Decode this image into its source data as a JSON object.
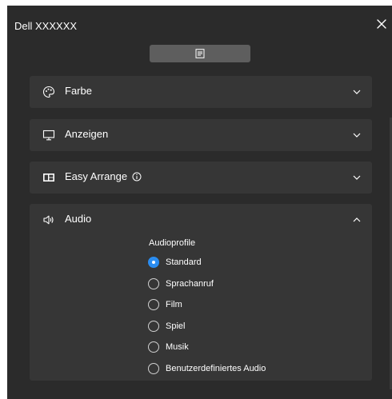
{
  "window": {
    "title": "Dell XXXXXX"
  },
  "toolbar": {
    "menu_icon": "document-list-icon",
    "close_icon": "close-icon"
  },
  "panels": [
    {
      "label": "Farbe",
      "icon": "color-palette-icon",
      "expanded": false
    },
    {
      "label": "Anzeigen",
      "icon": "monitor-icon",
      "expanded": false
    },
    {
      "label": "Easy Arrange",
      "icon": "layout-icon",
      "info_icon": "info-icon",
      "expanded": false
    },
    {
      "label": "Audio",
      "icon": "speaker-icon",
      "expanded": true
    }
  ],
  "audio": {
    "heading": "Audioprofile",
    "options": [
      {
        "label": "Standard",
        "selected": true
      },
      {
        "label": "Sprachanruf",
        "selected": false
      },
      {
        "label": "Film",
        "selected": false
      },
      {
        "label": "Spiel",
        "selected": false
      },
      {
        "label": "Musik",
        "selected": false
      },
      {
        "label": "Benutzerdefiniertes Audio",
        "selected": false
      }
    ]
  },
  "colors": {
    "background": "#2b2b2b",
    "panel": "#363636",
    "accent": "#2a8cf0",
    "menu_button": "#5e5e5e"
  }
}
